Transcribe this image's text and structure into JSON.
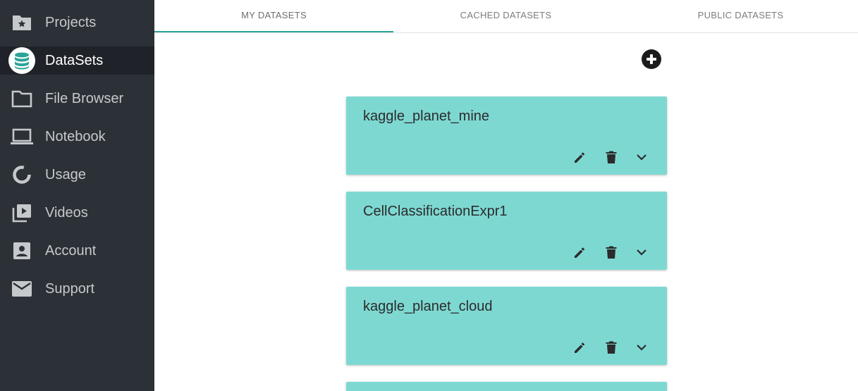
{
  "sidebar": {
    "items": [
      {
        "label": "Projects",
        "icon": "folder-star-icon"
      },
      {
        "label": "DataSets",
        "icon": "database-icon",
        "active": true
      },
      {
        "label": "File Browser",
        "icon": "folder-icon"
      },
      {
        "label": "Notebook",
        "icon": "laptop-icon"
      },
      {
        "label": "Usage",
        "icon": "donut-chart-icon"
      },
      {
        "label": "Videos",
        "icon": "video-library-icon"
      },
      {
        "label": "Account",
        "icon": "account-box-icon"
      },
      {
        "label": "Support",
        "icon": "mail-icon"
      }
    ]
  },
  "tabs": [
    {
      "label": "MY DATASETS",
      "active": true
    },
    {
      "label": "CACHED DATASETS",
      "active": false
    },
    {
      "label": "PUBLIC DATASETS",
      "active": false
    }
  ],
  "datasets": [
    {
      "name": "kaggle_planet_mine"
    },
    {
      "name": "CellClassificationExpr1"
    },
    {
      "name": "kaggle_planet_cloud"
    }
  ],
  "colors": {
    "sidebar_bg": "#2c3138",
    "sidebar_active_bg": "#1f2329",
    "accent": "#2aa498",
    "card_bg": "#7ed8d2"
  }
}
